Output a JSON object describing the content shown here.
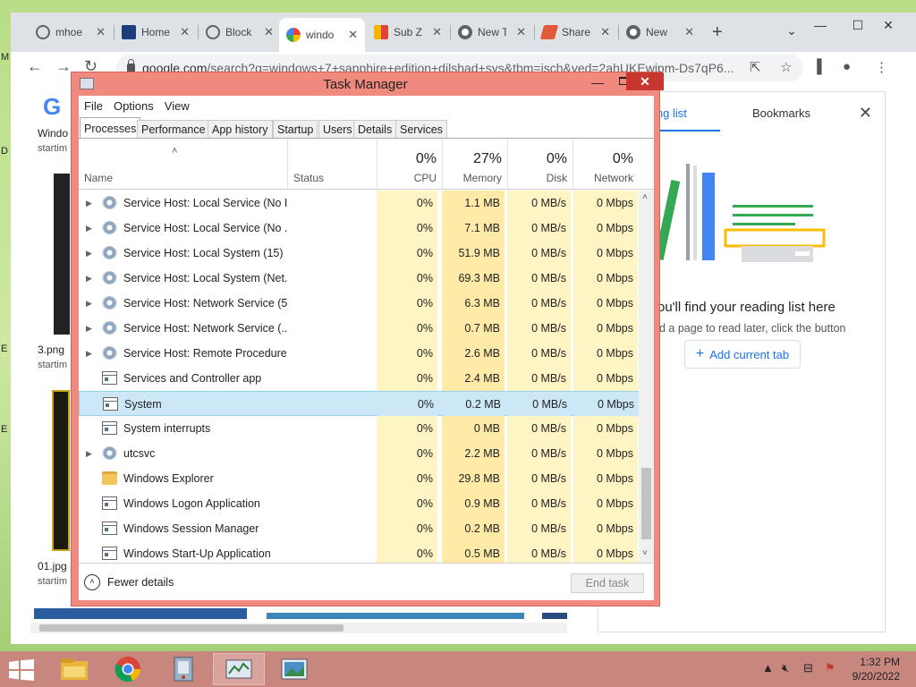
{
  "desktop": {
    "left_glyphs": [
      "M",
      "D",
      "E",
      "E"
    ]
  },
  "browser": {
    "tabs": [
      {
        "label": "mhoe",
        "icon": "globe-icon"
      },
      {
        "label": "Home",
        "icon": "site-logo-icon"
      },
      {
        "label": "Block",
        "icon": "globe-icon"
      },
      {
        "label": "windo",
        "icon": "google-icon"
      },
      {
        "label": "Sub Z",
        "icon": "slides-icon"
      },
      {
        "label": "New T",
        "icon": "chrome-icon"
      },
      {
        "label": "Share",
        "icon": "share-icon"
      },
      {
        "label": "New",
        "icon": "chrome-icon"
      }
    ],
    "url_host": "google.com",
    "url_rest": "/search?q=windows+7+sapphire+edition+dilshad+sys&tbm=isch&ved=2ahUKEwjpm-Ds7qP6...",
    "page": {
      "captions": [
        {
          "title": "Windo",
          "sub": "startim"
        },
        {
          "title": "3.png",
          "sub": "startim"
        },
        {
          "title": "01.jpg",
          "sub": "startim"
        }
      ]
    },
    "side_panel": {
      "tab_reading": "ing list",
      "tab_bookmarks": "Bookmarks",
      "heading": "ou'll find your reading list here",
      "text": "d a page to read later, click the button",
      "button_label": "Add current tab"
    }
  },
  "task_manager": {
    "title": "Task Manager",
    "menu": [
      "File",
      "Options",
      "View"
    ],
    "tabs": [
      "Processes",
      "Performance",
      "App history",
      "Startup",
      "Users",
      "Details",
      "Services"
    ],
    "header": {
      "name": "Name",
      "status": "Status",
      "cpu_pct": "0%",
      "cpu": "CPU",
      "mem_pct": "27%",
      "mem": "Memory",
      "disk_pct": "0%",
      "disk": "Disk",
      "net_pct": "0%",
      "net": "Network"
    },
    "rows": [
      {
        "name": "Service Host: Local Service (No I...",
        "cpu": "0%",
        "mem": "1.1 MB",
        "disk": "0 MB/s",
        "net": "0 Mbps",
        "icon": "gear",
        "expand": true
      },
      {
        "name": "Service Host: Local Service (No ...",
        "cpu": "0%",
        "mem": "7.1 MB",
        "disk": "0 MB/s",
        "net": "0 Mbps",
        "icon": "gear",
        "expand": true
      },
      {
        "name": "Service Host: Local System (15)",
        "cpu": "0%",
        "mem": "51.9 MB",
        "disk": "0 MB/s",
        "net": "0 Mbps",
        "icon": "gear",
        "expand": true
      },
      {
        "name": "Service Host: Local System (Net...",
        "cpu": "0%",
        "mem": "69.3 MB",
        "disk": "0 MB/s",
        "net": "0 Mbps",
        "icon": "gear",
        "expand": true
      },
      {
        "name": "Service Host: Network Service (5)",
        "cpu": "0%",
        "mem": "6.3 MB",
        "disk": "0 MB/s",
        "net": "0 Mbps",
        "icon": "gear",
        "expand": true
      },
      {
        "name": "Service Host: Network Service (...",
        "cpu": "0%",
        "mem": "0.7 MB",
        "disk": "0 MB/s",
        "net": "0 Mbps",
        "icon": "gear",
        "expand": true
      },
      {
        "name": "Service Host: Remote Procedure...",
        "cpu": "0%",
        "mem": "2.6 MB",
        "disk": "0 MB/s",
        "net": "0 Mbps",
        "icon": "gear",
        "expand": true
      },
      {
        "name": "Services and Controller app",
        "cpu": "0%",
        "mem": "2.4 MB",
        "disk": "0 MB/s",
        "net": "0 Mbps",
        "icon": "app",
        "expand": false
      },
      {
        "name": "System",
        "cpu": "0%",
        "mem": "0.2 MB",
        "disk": "0 MB/s",
        "net": "0 Mbps",
        "icon": "app",
        "expand": false,
        "selected": true
      },
      {
        "name": "System interrupts",
        "cpu": "0%",
        "mem": "0 MB",
        "disk": "0 MB/s",
        "net": "0 Mbps",
        "icon": "app",
        "expand": false
      },
      {
        "name": "utcsvc",
        "cpu": "0%",
        "mem": "2.2 MB",
        "disk": "0 MB/s",
        "net": "0 Mbps",
        "icon": "gear",
        "expand": true
      },
      {
        "name": "Windows Explorer",
        "cpu": "0%",
        "mem": "29.8 MB",
        "disk": "0 MB/s",
        "net": "0 Mbps",
        "icon": "folder",
        "expand": false
      },
      {
        "name": "Windows Logon Application",
        "cpu": "0%",
        "mem": "0.9 MB",
        "disk": "0 MB/s",
        "net": "0 Mbps",
        "icon": "app",
        "expand": false
      },
      {
        "name": "Windows Session Manager",
        "cpu": "0%",
        "mem": "0.2 MB",
        "disk": "0 MB/s",
        "net": "0 Mbps",
        "icon": "app",
        "expand": false
      },
      {
        "name": "Windows Start-Up Application",
        "cpu": "0%",
        "mem": "0.5 MB",
        "disk": "0 MB/s",
        "net": "0 Mbps",
        "icon": "app",
        "expand": false
      }
    ],
    "footer": {
      "fewer_details": "Fewer details",
      "end_task": "End task"
    }
  },
  "taskbar": {
    "apps": [
      "explorer-icon",
      "chrome-icon",
      "app-icon",
      "task-manager-icon",
      "picture-icon"
    ],
    "time": "1:32 PM",
    "date": "9/20/2022"
  },
  "colors": {
    "tm_frame": "#f08a7f",
    "tm_close": "#c7372f",
    "taskbar": "#c7877f",
    "selected_row": "#cce8f6",
    "accent_blue": "#1a73e8"
  }
}
